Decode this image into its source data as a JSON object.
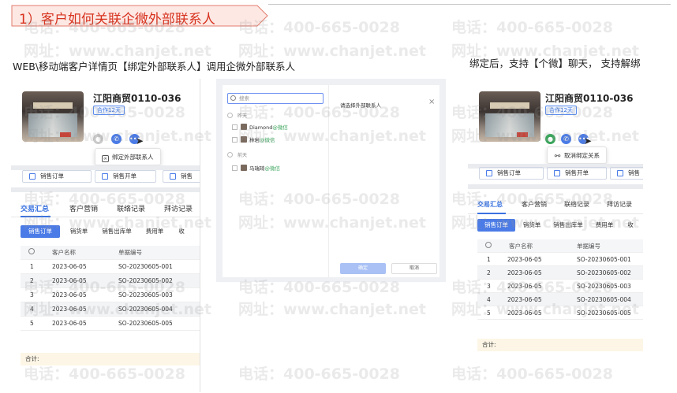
{
  "header": {
    "title": "1）客户如何关联企微外部联系人",
    "caption_left": "WEB\\移动端客户详情页【绑定外部联系人】调用企微外部联系人",
    "caption_right": "绑定后，支持【个微】聊天， 支持解绑"
  },
  "watermark": {
    "phone": "电话：400-665-0028",
    "site": "网址：www.chanjet.net"
  },
  "colors": {
    "title_red": "#d7321e",
    "accent_blue": "#3b73e0",
    "wechat_green": "#3ba55c"
  },
  "left_panel": {
    "company_name": "江阳商贸0110-036",
    "tag": "合作12天",
    "popover_action": "绑定外部联系人",
    "order_buttons": [
      "销售订单",
      "销售开单",
      "销售"
    ],
    "tabs": [
      "交易汇总",
      "客户营销",
      "联络记录",
      "拜访记录"
    ],
    "subtabs": [
      "销售订单",
      "销货单",
      "销售出库单",
      "费用单",
      "收"
    ],
    "table_headers": [
      "客户名称",
      "单据编号"
    ],
    "rows": [
      {
        "idx": "1",
        "date": "2023-06-05",
        "code": "SO-20230605-001"
      },
      {
        "idx": "2",
        "date": "2023-06-05",
        "code": "SO-20230605-002"
      },
      {
        "idx": "3",
        "date": "2023-06-05",
        "code": "SO-20230605-003"
      },
      {
        "idx": "4",
        "date": "2023-06-05",
        "code": "SO-20230605-004"
      },
      {
        "idx": "5",
        "date": "2023-06-05",
        "code": "SO-20230605-005"
      }
    ],
    "total_label": "合计:"
  },
  "dialog": {
    "search_placeholder": "搜索",
    "title": "请选择外部联系人",
    "close": "×",
    "group_1": "昨天",
    "group_2": "前天",
    "people": [
      {
        "name": "Diamond",
        "suffix": "@微信"
      },
      {
        "name": "林岩",
        "suffix": "@微信"
      },
      {
        "name": "马瑞琦",
        "suffix": "@微信"
      }
    ],
    "ok": "确定",
    "cancel": "取消"
  },
  "right_panel": {
    "company_name": "江阳商贸0110-036",
    "tag": "合作12天",
    "popover_action": "取消绑定关系",
    "order_buttons": [
      "销售订单",
      "销售开单",
      "销售"
    ],
    "tabs": [
      "交易汇总",
      "客户营销",
      "联络记录",
      "拜访记录"
    ],
    "subtabs": [
      "销售订单",
      "销货单",
      "销售出库单",
      "费用单",
      "收"
    ],
    "table_headers": [
      "客户名称",
      "单据编号"
    ],
    "rows": [
      {
        "idx": "1",
        "date": "2023-06-05",
        "code": "SO-20230605-001"
      },
      {
        "idx": "2",
        "date": "2023-06-05",
        "code": "SO-20230605-002"
      },
      {
        "idx": "3",
        "date": "2023-06-05",
        "code": "SO-20230605-003"
      },
      {
        "idx": "4",
        "date": "2023-06-05",
        "code": "SO-20230605-004"
      },
      {
        "idx": "5",
        "date": "2023-06-05",
        "code": "SO-20230605-005"
      }
    ],
    "total_label": "合计:"
  }
}
